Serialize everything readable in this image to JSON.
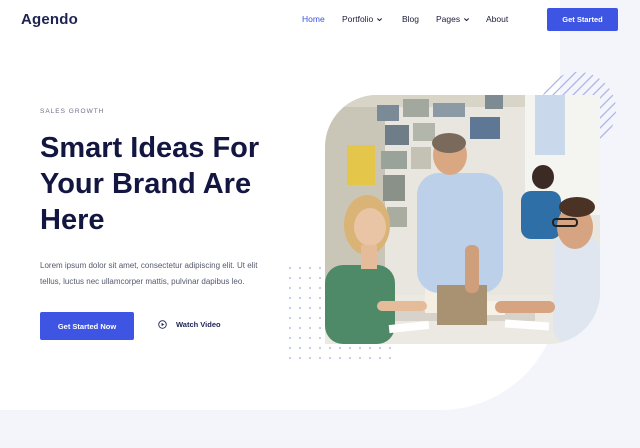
{
  "header": {
    "logo": "Agendo",
    "nav": [
      {
        "label": "Home",
        "active": true,
        "dropdown": false
      },
      {
        "label": "Portfolio",
        "active": false,
        "dropdown": true
      },
      {
        "label": "Blog",
        "active": false,
        "dropdown": false
      },
      {
        "label": "Pages",
        "active": false,
        "dropdown": true
      },
      {
        "label": "About",
        "active": false,
        "dropdown": false
      }
    ],
    "cta_label": "Get Started"
  },
  "hero": {
    "eyebrow": "SALES GROWTH",
    "headline_lines": [
      "Smart Ideas For",
      "Your Brand Are",
      "Here"
    ],
    "body_lines": [
      "Lorem ipsum dolor sit amet, consectetur adipiscing elit. Ut elit",
      "tellus, luctus nec ullamcorper mattis, pulvinar dapibus leo."
    ],
    "primary_cta": "Get Started Now",
    "secondary_cta": "Watch Video",
    "secondary_icon": "play-circle-icon"
  },
  "colors": {
    "accent": "#3e55e3",
    "heading": "#121640",
    "page_bg": "#f3f5fb"
  }
}
